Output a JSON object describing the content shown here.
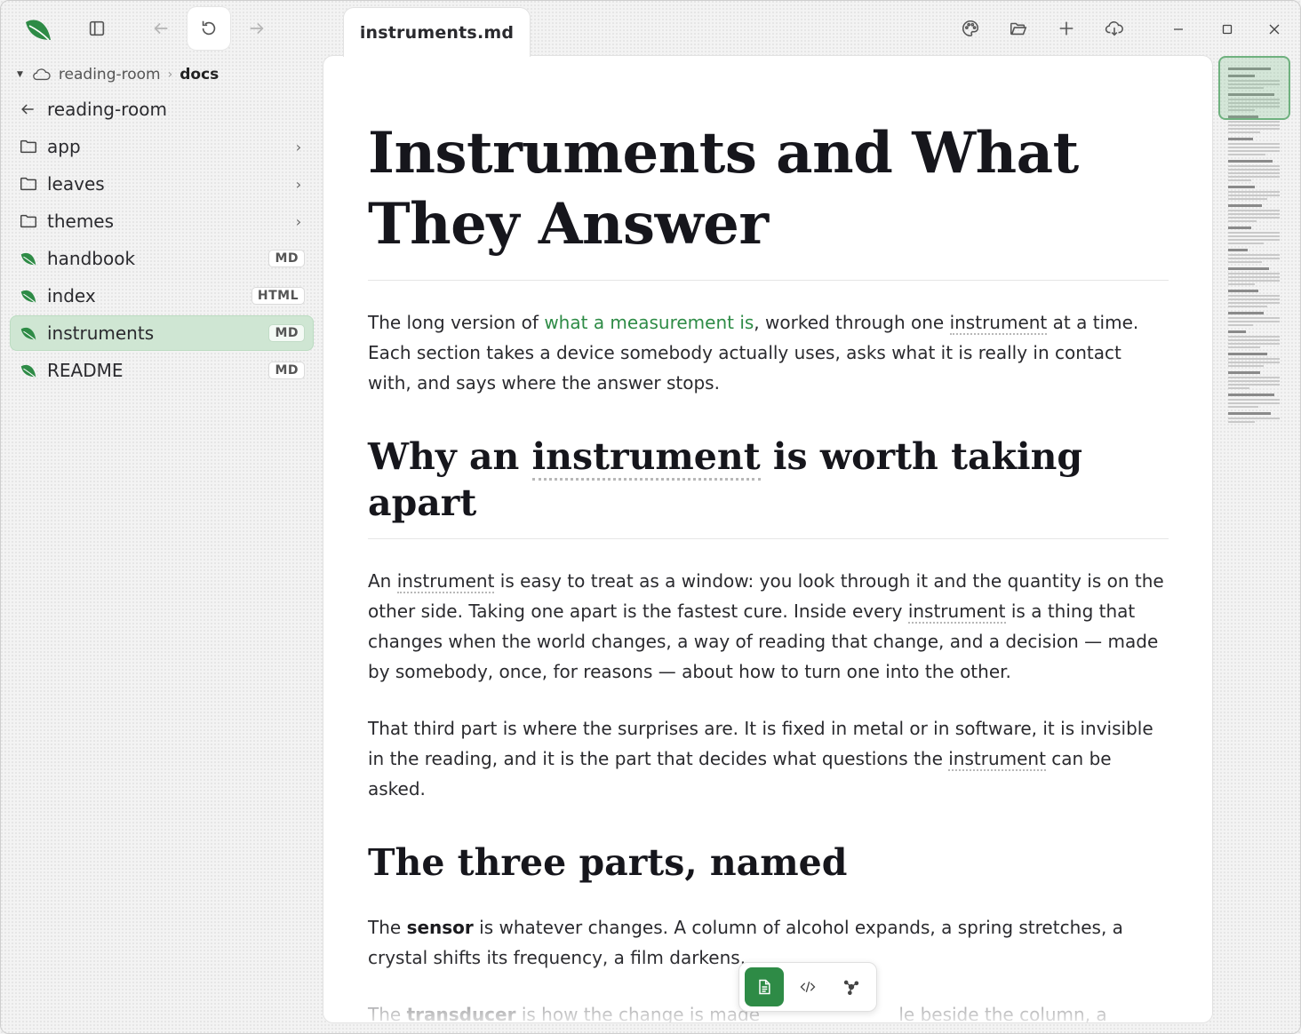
{
  "topbar": {
    "tab_title": "instruments.md",
    "icons": [
      "leaf-logo-icon",
      "sidebar-toggle-icon",
      "arrow-left-icon",
      "refresh-icon",
      "arrow-right-icon",
      "palette-icon",
      "folder-open-icon",
      "plus-icon",
      "cloud-download-icon",
      "minimize-icon",
      "maximize-icon",
      "close-icon"
    ]
  },
  "sidebar": {
    "breadcrumb": {
      "root": "reading-room",
      "current": "docs"
    },
    "back_label": "reading-room",
    "items": [
      {
        "label": "app",
        "kind": "folder"
      },
      {
        "label": "leaves",
        "kind": "folder"
      },
      {
        "label": "themes",
        "kind": "folder"
      },
      {
        "label": "handbook",
        "kind": "file",
        "badge": "MD"
      },
      {
        "label": "index",
        "kind": "file",
        "badge": "HTML"
      },
      {
        "label": "instruments",
        "kind": "file",
        "badge": "MD",
        "active": true
      },
      {
        "label": "README",
        "kind": "file",
        "badge": "MD"
      }
    ]
  },
  "doc": {
    "title": "Instruments and What They Answer",
    "intro": {
      "t1": "The long version of ",
      "link": "what a measurement is",
      "t2": ", worked through one ",
      "term": "instrument",
      "t3": " at a time. Each section takes a device somebody actually uses, asks what it is really in contact with, and says where the answer stops."
    },
    "h2_1": {
      "t1": "Why an ",
      "term": "instrument",
      "t2": " is worth taking apart"
    },
    "p2": {
      "t1": "An ",
      "term1": "instrument",
      "t2": " is easy to treat as a window: you look through it and the quantity is on the other side. Taking one apart is the fastest cure. Inside every ",
      "term2": "instrument",
      "t3": " is a thing that changes when the world changes, a way of reading that change, and a decision — made by somebody, once, for reasons — about how to turn one into the other."
    },
    "p3": {
      "t1": "That third part is where the surprises are. It is fixed in metal or in software, it is invisible in the reading, and it is the part that decides what questions the ",
      "term": "instrument",
      "t2": " can be asked."
    },
    "h2_2": "The three parts, named",
    "p4": {
      "t1": "The ",
      "bold": "sensor",
      "t2": " is whatever changes. A column of alcohol expands, a spring stretches, a crystal shifts its frequency, a film darkens."
    },
    "p5": {
      "t1": "The ",
      "bold": "transducer",
      "t2": " is how the change is made ",
      "t3": "le beside the column, a needle on a dial, a count of pulses."
    }
  },
  "accent_color": "#2e8b46",
  "switcher": {
    "icons": [
      "document-icon",
      "code-icon",
      "graph-icon"
    ],
    "active": "document-icon"
  }
}
